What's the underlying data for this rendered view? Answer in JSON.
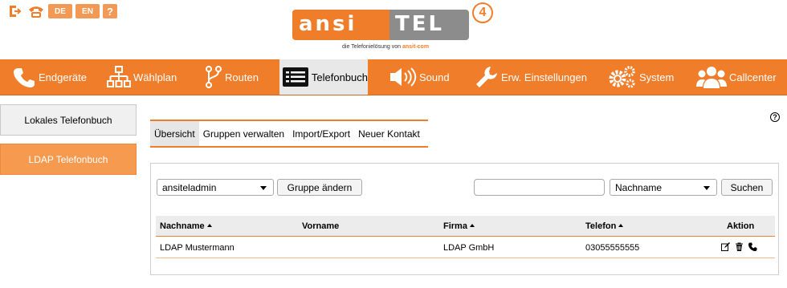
{
  "top_icons": [
    {
      "name": "logout-icon",
      "label": ""
    },
    {
      "name": "phone-icon",
      "label": ""
    },
    {
      "name": "lang-de",
      "label": "DE"
    },
    {
      "name": "lang-en",
      "label": "EN"
    },
    {
      "name": "help-icon",
      "label": "?"
    }
  ],
  "logo": {
    "left": "ansi",
    "right": "TEL",
    "version": "4",
    "tagline_prefix": "die Telefonielösung von",
    "tagline_brand": "ansit-com"
  },
  "nav": {
    "items": [
      {
        "label": "Endgeräte",
        "icon": "phone-icon"
      },
      {
        "label": "Wählplan",
        "icon": "sitemap-icon"
      },
      {
        "label": "Routen",
        "icon": "route-icon"
      },
      {
        "label": "Telefonbuch",
        "icon": "list-icon"
      },
      {
        "label": "Sound",
        "icon": "speaker-icon"
      },
      {
        "label": "Erw. Einstellungen",
        "icon": "wrench-icon"
      },
      {
        "label": "System",
        "icon": "gears-icon"
      },
      {
        "label": "Callcenter",
        "icon": "users-icon"
      }
    ],
    "active": "Telefonbuch",
    "accent_color": "#f07d2a"
  },
  "sidebar": {
    "items": [
      {
        "label": "Lokales Telefonbuch"
      },
      {
        "label": "LDAP Telefonbuch"
      }
    ],
    "active": "LDAP Telefonbuch"
  },
  "tabs": {
    "items": [
      {
        "label": "Übersicht"
      },
      {
        "label": "Gruppen verwalten"
      },
      {
        "label": "Import/Export"
      },
      {
        "label": "Neuer Kontakt"
      }
    ],
    "active": "Übersicht"
  },
  "toolbar": {
    "group_select_value": "ansiteladmin",
    "change_group_label": "Gruppe ändern",
    "search_value": "",
    "search_field_select_value": "Nachname",
    "search_button_label": "Suchen"
  },
  "table": {
    "columns": [
      "Nachname",
      "Vorname",
      "Firma",
      "Telefon",
      "Aktion"
    ],
    "rows": [
      {
        "nachname": "LDAP Mustermann",
        "vorname": "",
        "firma": "LDAP GmbH",
        "telefon": "03055555555"
      }
    ]
  }
}
